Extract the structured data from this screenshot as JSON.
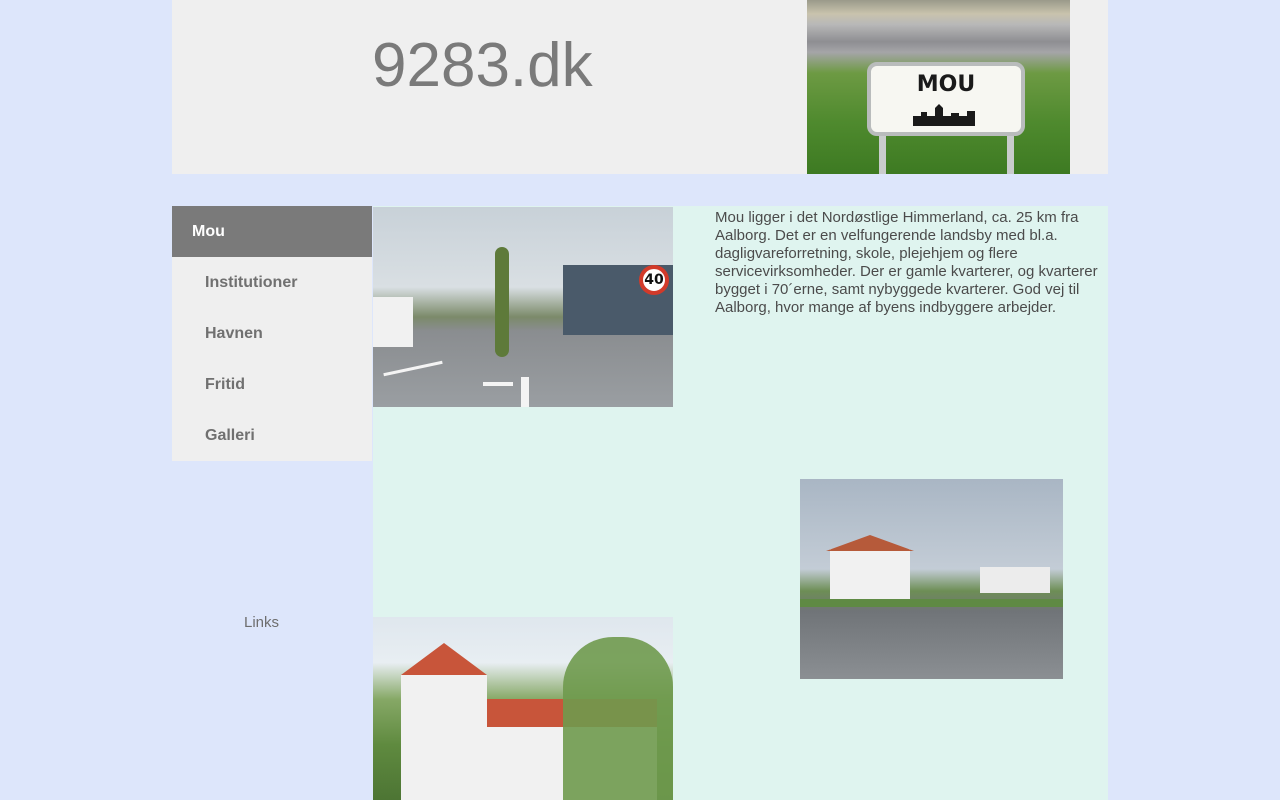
{
  "header": {
    "site_title": "9283.dk",
    "sign_text": "MOU"
  },
  "nav": {
    "items": [
      {
        "label": "Mou",
        "active": true
      },
      {
        "label": "Institutioner",
        "active": false
      },
      {
        "label": "Havnen",
        "active": false
      },
      {
        "label": "Fritid",
        "active": false
      },
      {
        "label": "Galleri",
        "active": false
      }
    ],
    "links_label": "Links"
  },
  "main": {
    "intro_text": "Mou ligger i det Nordøstlige Himmerland, ca. 25 km fra Aalborg. Det er en velfungerende landsby med bl.a. dagligvareforretning, skole, plejehjem og flere servicevirksomheder. Der er gamle kvarterer, og kvarterer bygget i 70´erne, samt nybyggede kvarterer. God vej til Aalborg, hvor mange af byens indbyggere arbejder.",
    "speed_sign": "40"
  },
  "colors": {
    "page_bg": "#dde6fb",
    "header_bg": "#efefef",
    "content_bg": "#dff4ef",
    "nav_active_bg": "#7a7a7a",
    "nav_text": "#707070"
  }
}
